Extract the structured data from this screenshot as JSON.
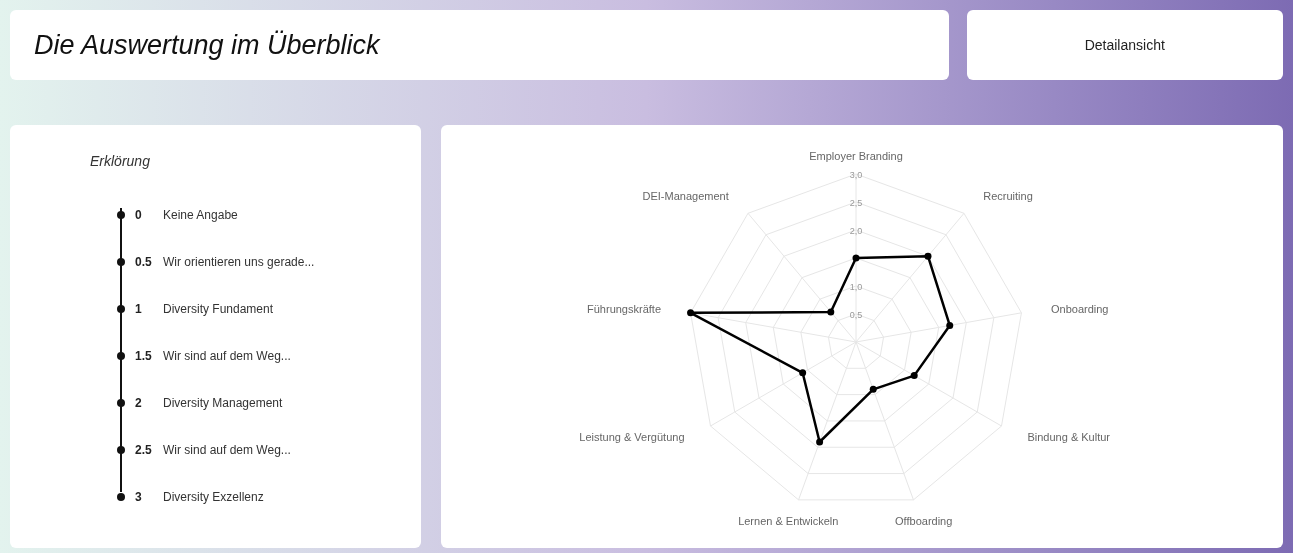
{
  "header": {
    "title": "Die Auswertung im Überblick",
    "button": "Detailansicht"
  },
  "legend": {
    "title": "Erklörung",
    "items": [
      {
        "value": "0",
        "label": "Keine Angabe"
      },
      {
        "value": "0.5",
        "label": "Wir orientieren uns gerade..."
      },
      {
        "value": "1",
        "label": "Diversity Fundament"
      },
      {
        "value": "1.5",
        "label": "Wir sind auf dem Weg..."
      },
      {
        "value": "2",
        "label": "Diversity Management"
      },
      {
        "value": "2.5",
        "label": "Wir sind auf dem Weg..."
      },
      {
        "value": "3",
        "label": "Diversity Exzellenz"
      }
    ]
  },
  "chart": {
    "chart_data": {
      "type": "radar",
      "categories": [
        "Employer Branding",
        "Recruiting",
        "Onboarding",
        "Bindung & Kultur",
        "Offboarding",
        "Lernen & Entwickeln",
        "Leistung & Vergütung",
        "Führungskräfte",
        "DEI-Management"
      ],
      "series": [
        {
          "color": "#000000",
          "values": [
            1.5,
            2,
            1.7,
            1.2,
            0.9,
            1.9,
            1.1,
            3,
            0.7
          ]
        }
      ],
      "ylim": [
        0,
        3
      ],
      "yticks": [
        {
          "value": 0.5,
          "label": "0,5"
        },
        {
          "value": 1,
          "label": "1,0"
        },
        {
          "value": 2,
          "label": "2,0"
        },
        {
          "value": 2.5,
          "label": "2,5"
        },
        {
          "value": 3,
          "label": "3,0"
        }
      ]
    }
  }
}
